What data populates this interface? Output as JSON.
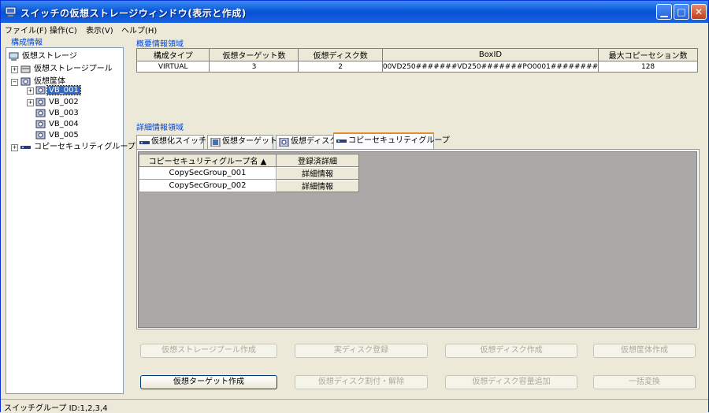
{
  "window": {
    "title": "スイッチの仮想ストレージウィンドウ(表示と作成)"
  },
  "menu": [
    "ファイル(F)",
    "操作(C)",
    "表示(V)",
    "ヘルプ(H)"
  ],
  "left_panel": {
    "label": "構成情報",
    "tree": {
      "root": "仮想ストレージ",
      "pool": "仮想ストレージプール",
      "chassis_group": "仮想筐体",
      "vbs": [
        "VB_001",
        "VB_002",
        "VB_003",
        "VB_004",
        "VB_005"
      ],
      "selected_vb": "VB_001",
      "copy_security": "コピーセキュリティグループ"
    }
  },
  "summary": {
    "label": "概要情報領域",
    "columns": [
      "構成タイプ",
      "仮想ターゲット数",
      "仮想ディスク数",
      "BoxID",
      "最大コピーセション数"
    ],
    "row": [
      "VIRTUAL",
      "3",
      "2",
      "00VD250#######VD250#######PO0001########",
      "128"
    ]
  },
  "detail": {
    "label": "詳細情報領域",
    "tabs": [
      "仮想化スイッチ",
      "仮想ターゲット",
      "仮想ディスク",
      "コピーセキュリティグループ"
    ],
    "active_tab": "コピーセキュリティグループ",
    "grid": {
      "columns": [
        "コピーセキュリティグループ名 ▲",
        "登録済詳細"
      ],
      "rows": [
        {
          "name": "CopySecGroup_001",
          "action": "詳細情報"
        },
        {
          "name": "CopySecGroup_002",
          "action": "詳細情報"
        }
      ]
    }
  },
  "buttons": {
    "row1": [
      "仮想ストレージプール作成",
      "実ディスク登録",
      "仮想ディスク作成",
      "仮想筐体作成"
    ],
    "row2": [
      "仮想ターゲット作成",
      "仮想ディスク割付・解除",
      "仮想ディスク容量追加",
      "一括変換"
    ],
    "enabled": "仮想ターゲット作成"
  },
  "status": {
    "text": "スイッチグループ ID:1,2,3,4"
  }
}
